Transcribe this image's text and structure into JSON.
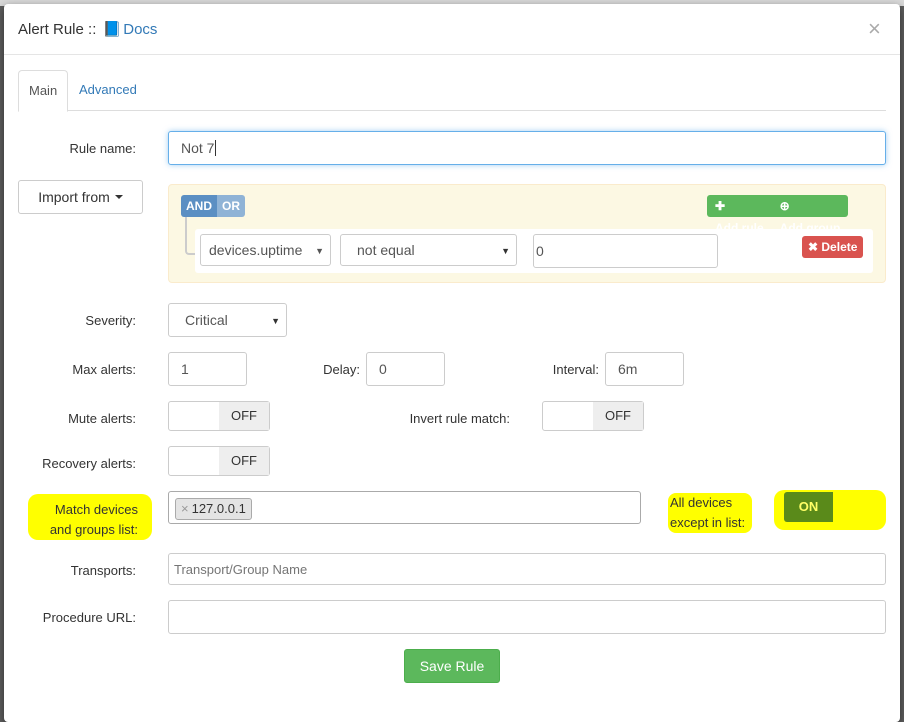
{
  "modal": {
    "title_prefix": "Alert Rule ::",
    "docs_label": "Docs",
    "close": "×"
  },
  "tabs": [
    {
      "label": "Main"
    },
    {
      "label": "Advanced"
    }
  ],
  "form": {
    "rule_name_label": "Rule name:",
    "rule_name_value": "Not 7",
    "import_from_label": "Import from",
    "severity_label": "Severity:",
    "severity_value": "Critical",
    "max_alerts_label": "Max alerts:",
    "max_alerts_value": "1",
    "delay_label": "Delay:",
    "delay_value": "0",
    "interval_label": "Interval:",
    "interval_value": "6m",
    "mute_alerts_label": "Mute alerts:",
    "mute_alerts_state": "OFF",
    "invert_label": "Invert rule match:",
    "invert_state": "OFF",
    "recovery_label": "Recovery alerts:",
    "recovery_state": "OFF",
    "match_devices_label_1": "Match devices",
    "match_devices_label_2": "and groups list:",
    "match_devices_tags": [
      "127.0.0.1"
    ],
    "all_devices_label_1": "All devices",
    "all_devices_label_2": "except in list:",
    "all_devices_state": "ON",
    "transports_label": "Transports:",
    "transports_placeholder": "Transport/Group Name",
    "procedure_label": "Procedure URL:",
    "procedure_value": "",
    "save_label": "Save Rule"
  },
  "query_builder": {
    "and_label": "AND",
    "or_label": "OR",
    "add_rule_label": "Add rule",
    "add_group_label": "Add group",
    "field_value": "devices.uptime",
    "operator_value": "not equal",
    "rule_value": "0",
    "delete_label": "Delete"
  },
  "colors": {
    "highlight": "#ffff00",
    "success": "#5cb85c",
    "danger": "#d9534f",
    "link": "#337ab7"
  }
}
